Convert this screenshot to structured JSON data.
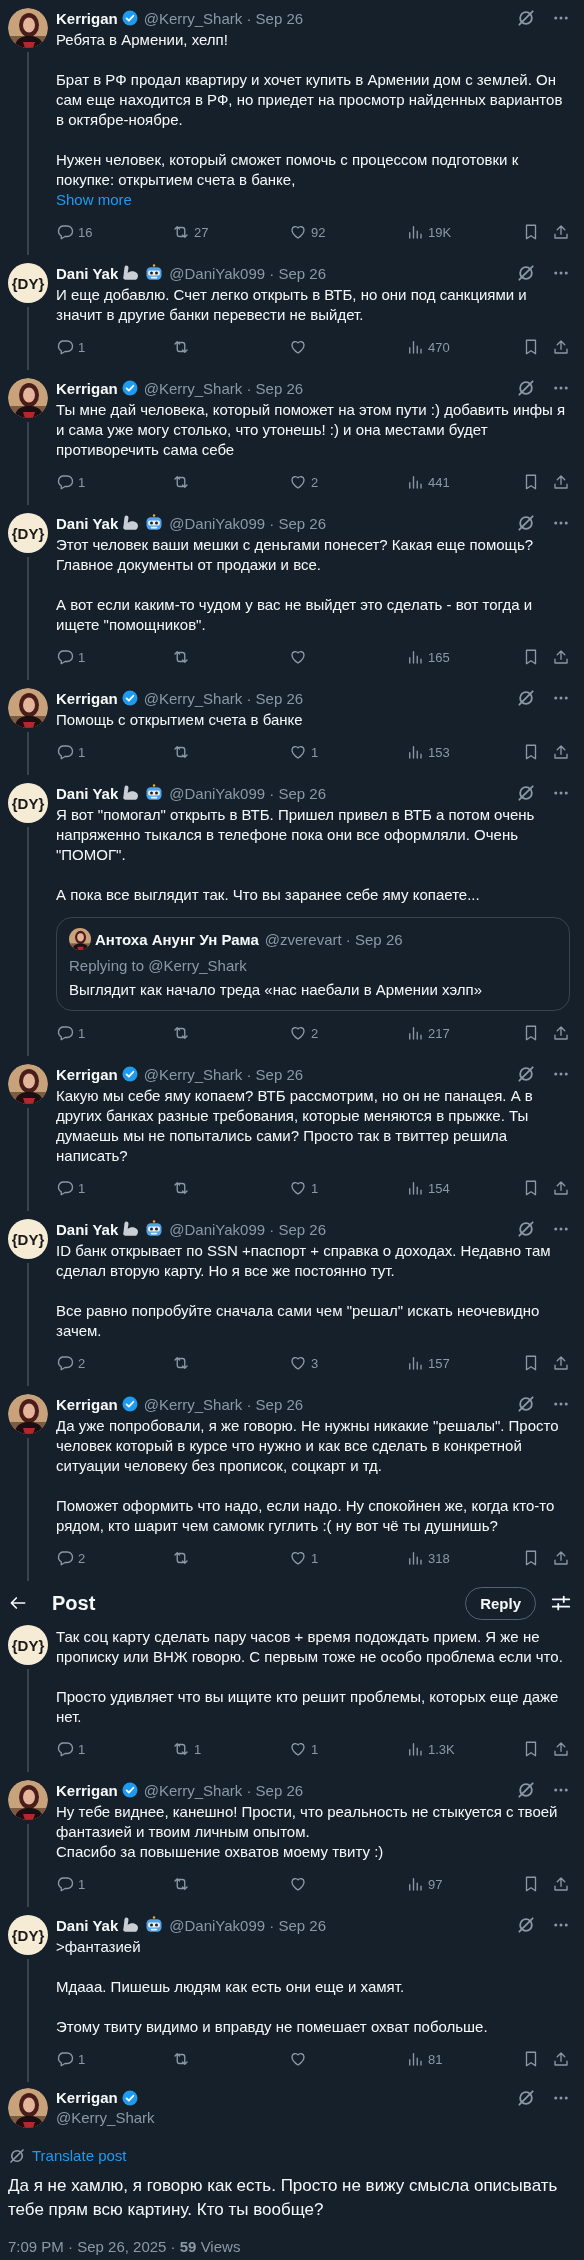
{
  "header": {
    "title": "Post",
    "reply_button": "Reply"
  },
  "tweets": [
    {
      "kind": "reply",
      "name": "Kerrigan",
      "verified": true,
      "meta": "@Kerry_Shark · Sep 26",
      "text": "Ребята в Армении, хелп!\n\nБрат в РФ продал квартиру и хочет купить в Армении дом с землей. Он сам еще находится в РФ, но приедет на просмотр найденных вариантов в октябре-ноябре.\n\nНужен человек, который сможет помочь с процессом подготовки к покупке: открытием счета в банке,",
      "show_more": "Show more",
      "stats": {
        "replies": "16",
        "reposts": "27",
        "likes": "92",
        "views": "19K"
      }
    },
    {
      "kind": "reply",
      "avatar": {
        "kind": "initials",
        "text": "{DY}"
      },
      "name": "Dani Yak",
      "name_emoji": [
        {
          "kind": "arm"
        },
        {
          "kind": "robot"
        }
      ],
      "verified": false,
      "meta": "@DaniYak099 · Sep 26",
      "text": "И еще добавлю. Счет легко открыть в ВТБ, но они под санкциями и значит в другие банки перевести не выйдет.",
      "stats": {
        "replies": "1",
        "views": "470"
      }
    },
    {
      "kind": "reply",
      "name": "Kerrigan",
      "verified": true,
      "meta": "@Kerry_Shark · Sep 26",
      "text": "Ты мне дай человека, который поможет на этом пути :) добавить инфы я и сама уже могу столько, что утонешь! :) и она местами будет противоречить сама себе",
      "stats": {
        "replies": "1",
        "likes": "2",
        "views": "441"
      }
    },
    {
      "kind": "reply",
      "avatar": {
        "kind": "initials",
        "text": "{DY}"
      },
      "name": "Dani Yak",
      "name_emoji": [
        {
          "kind": "arm"
        },
        {
          "kind": "robot"
        }
      ],
      "verified": false,
      "meta": "@DaniYak099 · Sep 26",
      "text": "Этот человек ваши мешки с деньгами понесет? Какая еще помощь? Главное документы от продажи и все.\n\nА вот если каким-то чудом у вас не выйдет это сделать - вот тогда и ищете \"помощников\".",
      "stats": {
        "replies": "1",
        "views": "165"
      }
    },
    {
      "kind": "reply",
      "name": "Kerrigan",
      "verified": true,
      "meta": "@Kerry_Shark · Sep 26",
      "text": "Помощь с открытием счета в банке",
      "stats": {
        "replies": "1",
        "likes": "1",
        "views": "153"
      }
    },
    {
      "kind": "reply",
      "avatar": {
        "kind": "initials",
        "text": "{DY}"
      },
      "name": "Dani Yak",
      "name_emoji": [
        {
          "kind": "arm"
        },
        {
          "kind": "robot"
        }
      ],
      "verified": false,
      "meta": "@DaniYak099 · Sep 26",
      "text": "Я вот \"помогал\" открыть в ВТБ. Пришел привел в ВТБ а потом очень напряженно тыкался в телефоне пока они все оформляли. Очень \"ПОМОГ\".\n\nА пока все выглядит так. Что вы заранее себе яму копаете...",
      "quote": {
        "name": "Антоха Анунг Ун Рама",
        "meta": "@zverevart · Sep 26",
        "replying": "Replying to @Kerry_Shark",
        "text": "Выглядит как начало треда «нас наебали в Армении хэлп»"
      },
      "stats": {
        "replies": "1",
        "likes": "2",
        "views": "217"
      }
    },
    {
      "kind": "reply",
      "name": "Kerrigan",
      "verified": true,
      "meta": "@Kerry_Shark · Sep 26",
      "text": "Какую мы себе яму копаем? ВТБ рассмотрим, но он не панацея. А в других банках разные требования, которые меняются в прыжке. Ты думаешь мы не попытались сами? Просто так в твиттер решила написать?",
      "stats": {
        "replies": "1",
        "likes": "1",
        "views": "154"
      }
    },
    {
      "kind": "reply",
      "avatar": {
        "kind": "initials",
        "text": "{DY}"
      },
      "name": "Dani Yak",
      "name_emoji": [
        {
          "kind": "arm"
        },
        {
          "kind": "robot"
        }
      ],
      "verified": false,
      "meta": "@DaniYak099 · Sep 26",
      "text": "ID банк открывает по SSN +паспорт + справка о доходах. Недавно там сделал вторую карту. Но я все же постоянно тут.\n\nВсе равно попробуйте сначала сами чем \"решал\" искать неочевидно зачем.",
      "stats": {
        "replies": "2",
        "likes": "3",
        "views": "157"
      }
    },
    {
      "kind": "reply",
      "name": "Kerrigan",
      "verified": true,
      "meta": "@Kerry_Shark · Sep 26",
      "text": "Да уже попробовали, я же говорю. Не нужны никакие \"решалы\". Просто человек который в курсе что нужно и как все сделать в конкретной ситуации человеку без прописок, соцкарт и тд.\n\nПоможет оформить что надо, если надо. Ну спокойнен же, когда кто-то рядом, кто шарит чем самомк гуглить :( ну вот чё ты душнишь?",
      "stats": {
        "replies": "2",
        "likes": "1",
        "views": "318"
      }
    },
    {
      "kind": "under_header",
      "avatar": {
        "kind": "initials",
        "text": "{DY}"
      },
      "text": "Так соц карту сделать пару часов + время подождать прием. Я же не прописку или ВНЖ говорю. С первым тоже не особо проблема если что.\n\nПросто удивляет что вы ищите кто решит проблемы, которых еще даже нет.",
      "stats": {
        "replies": "1",
        "reposts": "1",
        "likes": "1",
        "views": "1.3K"
      }
    },
    {
      "kind": "reply",
      "name": "Kerrigan",
      "verified": true,
      "meta": "@Kerry_Shark · Sep 26",
      "text": "Ну тебе виднее, канешно! Прости, что реальность не стыкуется с твоей фантазией и твоим личным опытом.\nСпасибо за повышение охватов моему твиту :)",
      "stats": {
        "replies": "1",
        "views": "97"
      }
    },
    {
      "kind": "reply",
      "avatar": {
        "kind": "initials",
        "text": "{DY}"
      },
      "name": "Dani Yak",
      "name_emoji": [
        {
          "kind": "arm"
        },
        {
          "kind": "robot"
        }
      ],
      "verified": false,
      "meta": "@DaniYak099 · Sep 26",
      "text": ">фантазией\n\nМдааа. Пишешь людям как есть они еще и хамят.\n\nЭтому твиту видимо и вправду не помешает охват побольше.",
      "stats": {
        "replies": "1",
        "views": "81"
      }
    }
  ],
  "main": {
    "name": "Kerrigan",
    "verified": true,
    "handle": "@Kerry_Shark",
    "translate": "Translate post",
    "text": "Да я не хамлю, я говорю как есть. Просто не вижу смысла описывать тебе прям всю картину. Кто ты вообще?",
    "footer": "7:09 PM · Sep 26, 2025 · **59** Views"
  }
}
